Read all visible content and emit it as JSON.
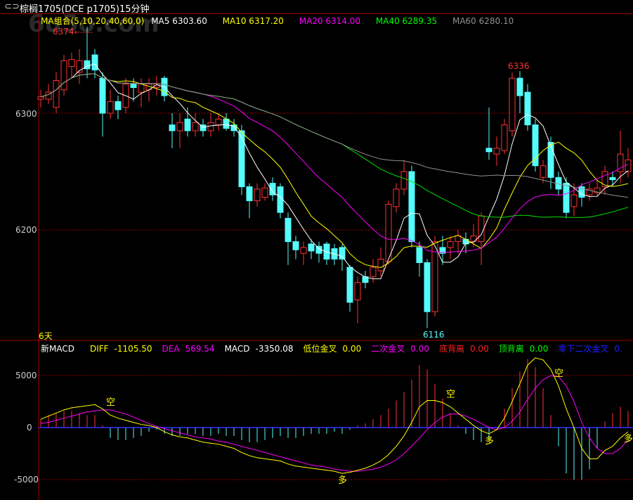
{
  "title": "棕榈1705(DCE p1705)15分钟",
  "title_icon": "link-icon",
  "watermark": "6u5o.com",
  "legend": {
    "group": "MA组合(5,10,20,40,60,0)",
    "ma5": "MA5 6303.60",
    "ma10": "MA10 6317.20",
    "ma20": "MA20 6314.00",
    "ma40": "MA40 6289.35",
    "ma60": "MA60 6280.10"
  },
  "colors": {
    "up": "#ff3232",
    "down": "#54fcfc",
    "ma5": "#ffffff",
    "ma10": "#ffff00",
    "ma20": "#ff00ff",
    "ma40": "#00e000",
    "ma60": "#909090",
    "grid": "#a00000",
    "zero": "#3232ff"
  },
  "price_axis": [
    "6300",
    "6200"
  ],
  "macd_axis": [
    "5000",
    "0",
    "-5000"
  ],
  "annotations": {
    "high": "6374",
    "high_arrow": "←-----",
    "peak": "6336",
    "low": "6116",
    "days": "6天"
  },
  "macd_header": [
    {
      "label": "新MACD",
      "value": "",
      "color": "#ffffff"
    },
    {
      "label": "DIFF",
      "value": "-1105.50",
      "color": "#ffff00"
    },
    {
      "label": "DEA",
      "value": "569.54",
      "color": "#ff00ff"
    },
    {
      "label": "MACD",
      "value": "-3350.08",
      "color": "#ffffff"
    },
    {
      "label": "低位金叉",
      "value": "0.00",
      "color": "#ffff00"
    },
    {
      "label": "二次金叉",
      "value": "0.00",
      "color": "#ff00ff"
    },
    {
      "label": "底背离",
      "value": "0.00",
      "color": "#ff2020"
    },
    {
      "label": "顶背离",
      "value": "0.00",
      "color": "#00ff00"
    },
    {
      "label": "零下二次金叉",
      "value": "0.",
      "color": "#2020ff"
    }
  ],
  "signals": [
    {
      "t": "空",
      "i": 9
    },
    {
      "t": "多",
      "i": 39
    },
    {
      "t": "空",
      "i": 53
    },
    {
      "t": "多",
      "i": 58
    },
    {
      "t": "空",
      "i": 67
    },
    {
      "t": "多",
      "i": 76
    }
  ],
  "chart_data": {
    "type": "candlestick",
    "ylim": [
      6110,
      6385
    ],
    "candles": [
      [
        6312,
        6314,
        6320,
        6305
      ],
      [
        6312,
        6318,
        6325,
        6308
      ],
      [
        6305,
        6328,
        6335,
        6300
      ],
      [
        6320,
        6345,
        6350,
        6315
      ],
      [
        6340,
        6346,
        6352,
        6330
      ],
      [
        6335,
        6345,
        6355,
        6325
      ],
      [
        6345,
        6338,
        6374,
        6330
      ],
      [
        6350,
        6337,
        6355,
        6330
      ],
      [
        6330,
        6300,
        6335,
        6280
      ],
      [
        6300,
        6310,
        6320,
        6295
      ],
      [
        6310,
        6303,
        6315,
        6295
      ],
      [
        6305,
        6325,
        6330,
        6300
      ],
      [
        6325,
        6322,
        6330,
        6310
      ],
      [
        6318,
        6325,
        6330,
        6305
      ],
      [
        6320,
        6325,
        6330,
        6310
      ],
      [
        6322,
        6325,
        6332,
        6315
      ],
      [
        6330,
        6315,
        6332,
        6310
      ],
      [
        6290,
        6285,
        6300,
        6270
      ],
      [
        6285,
        6292,
        6300,
        6270
      ],
      [
        6295,
        6285,
        6305,
        6280
      ],
      [
        6285,
        6292,
        6300,
        6280
      ],
      [
        6290,
        6285,
        6295,
        6280
      ],
      [
        6285,
        6292,
        6300,
        6280
      ],
      [
        6290,
        6295,
        6300,
        6285
      ],
      [
        6295,
        6287,
        6300,
        6285
      ],
      [
        6290,
        6285,
        6295,
        6280
      ],
      [
        6285,
        6237,
        6290,
        6230
      ],
      [
        6237,
        6225,
        6240,
        6210
      ],
      [
        6225,
        6235,
        6240,
        6220
      ],
      [
        6228,
        6236,
        6240,
        6225
      ],
      [
        6240,
        6230,
        6245,
        6225
      ],
      [
        6237,
        6215,
        6240,
        6210
      ],
      [
        6210,
        6190,
        6215,
        6170
      ],
      [
        6190,
        6183,
        6195,
        6175
      ],
      [
        6180,
        6185,
        6190,
        6170
      ],
      [
        6188,
        6182,
        6192,
        6175
      ],
      [
        6186,
        6180,
        6190,
        6172
      ],
      [
        6188,
        6175,
        6190,
        6170
      ],
      [
        6184,
        6175,
        6188,
        6170
      ],
      [
        6185,
        6175,
        6188,
        6165
      ],
      [
        6168,
        6138,
        6170,
        6130
      ],
      [
        6140,
        6155,
        6160,
        6120
      ],
      [
        6160,
        6155,
        6165,
        6150
      ],
      [
        6160,
        6168,
        6175,
        6155
      ],
      [
        6165,
        6175,
        6185,
        6160
      ],
      [
        6173,
        6222,
        6225,
        6170
      ],
      [
        6220,
        6235,
        6240,
        6215
      ],
      [
        6235,
        6250,
        6260,
        6230
      ],
      [
        6250,
        6190,
        6255,
        6185
      ],
      [
        6185,
        6172,
        6190,
        6160
      ],
      [
        6172,
        6130,
        6175,
        6116
      ],
      [
        6130,
        6190,
        6195,
        6126
      ],
      [
        6185,
        6180,
        6195,
        6170
      ],
      [
        6185,
        6190,
        6195,
        6175
      ],
      [
        6190,
        6195,
        6200,
        6180
      ],
      [
        6192,
        6188,
        6198,
        6180
      ],
      [
        6190,
        6195,
        6205,
        6185
      ],
      [
        6190,
        6212,
        6215,
        6170
      ],
      [
        6270,
        6267,
        6305,
        6260
      ],
      [
        6265,
        6270,
        6280,
        6255
      ],
      [
        6268,
        6290,
        6295,
        6265
      ],
      [
        6285,
        6330,
        6335,
        6280
      ],
      [
        6330,
        6315,
        6336,
        6300
      ],
      [
        6318,
        6290,
        6325,
        6285
      ],
      [
        6290,
        6255,
        6295,
        6250
      ],
      [
        6245,
        6255,
        6260,
        6240
      ],
      [
        6275,
        6245,
        6280,
        6235
      ],
      [
        6245,
        6235,
        6250,
        6230
      ],
      [
        6240,
        6215,
        6245,
        6210
      ],
      [
        6220,
        6230,
        6240,
        6212
      ],
      [
        6237,
        6228,
        6240,
        6220
      ],
      [
        6230,
        6235,
        6240,
        6225
      ],
      [
        6232,
        6236,
        6242,
        6228
      ],
      [
        6237,
        6250,
        6255,
        6230
      ],
      [
        6245,
        6243,
        6250,
        6238
      ],
      [
        6250,
        6265,
        6285,
        6240
      ],
      [
        6250,
        6260,
        6270,
        6245
      ]
    ],
    "macd": {
      "ylim": [
        -6800,
        6800
      ],
      "diff": [
        800,
        1100,
        1400,
        1700,
        1900,
        2000,
        2100,
        2200,
        1800,
        1200,
        900,
        700,
        500,
        300,
        200,
        0,
        -400,
        -700,
        -900,
        -1000,
        -1200,
        -1400,
        -1500,
        -1600,
        -1800,
        -2000,
        -2400,
        -2700,
        -2900,
        -3000,
        -3100,
        -3200,
        -3500,
        -3700,
        -3800,
        -3900,
        -4000,
        -4100,
        -4200,
        -4400,
        -4300,
        -4100,
        -3900,
        -3600,
        -3200,
        -2600,
        -1800,
        -800,
        500,
        2000,
        2600,
        2600,
        2400,
        2000,
        1400,
        800,
        200,
        -300,
        -600,
        -200,
        900,
        2500,
        4200,
        6000,
        6700,
        6500,
        5600,
        4000,
        1800,
        0,
        -2000,
        -3000,
        -3000,
        -2200,
        -1800,
        -1000,
        -400
      ],
      "dea": [
        400,
        500,
        700,
        900,
        1100,
        1300,
        1500,
        1600,
        1700,
        1700,
        1500,
        1300,
        1000,
        700,
        400,
        100,
        -100,
        -300,
        -500,
        -700,
        -900,
        -1000,
        -1100,
        -1300,
        -1400,
        -1600,
        -1800,
        -2000,
        -2200,
        -2400,
        -2600,
        -2800,
        -3000,
        -3200,
        -3400,
        -3600,
        -3700,
        -3800,
        -4000,
        -4100,
        -4200,
        -4200,
        -4100,
        -4000,
        -3800,
        -3500,
        -3100,
        -2500,
        -1800,
        -1000,
        -200,
        500,
        1000,
        1300,
        1300,
        1100,
        800,
        400,
        0,
        -200,
        0,
        600,
        1500,
        2700,
        3800,
        4600,
        5000,
        4900,
        4000,
        2500,
        500,
        -1000,
        -2000,
        -2500,
        -2500,
        -2000,
        -1200
      ]
    }
  }
}
